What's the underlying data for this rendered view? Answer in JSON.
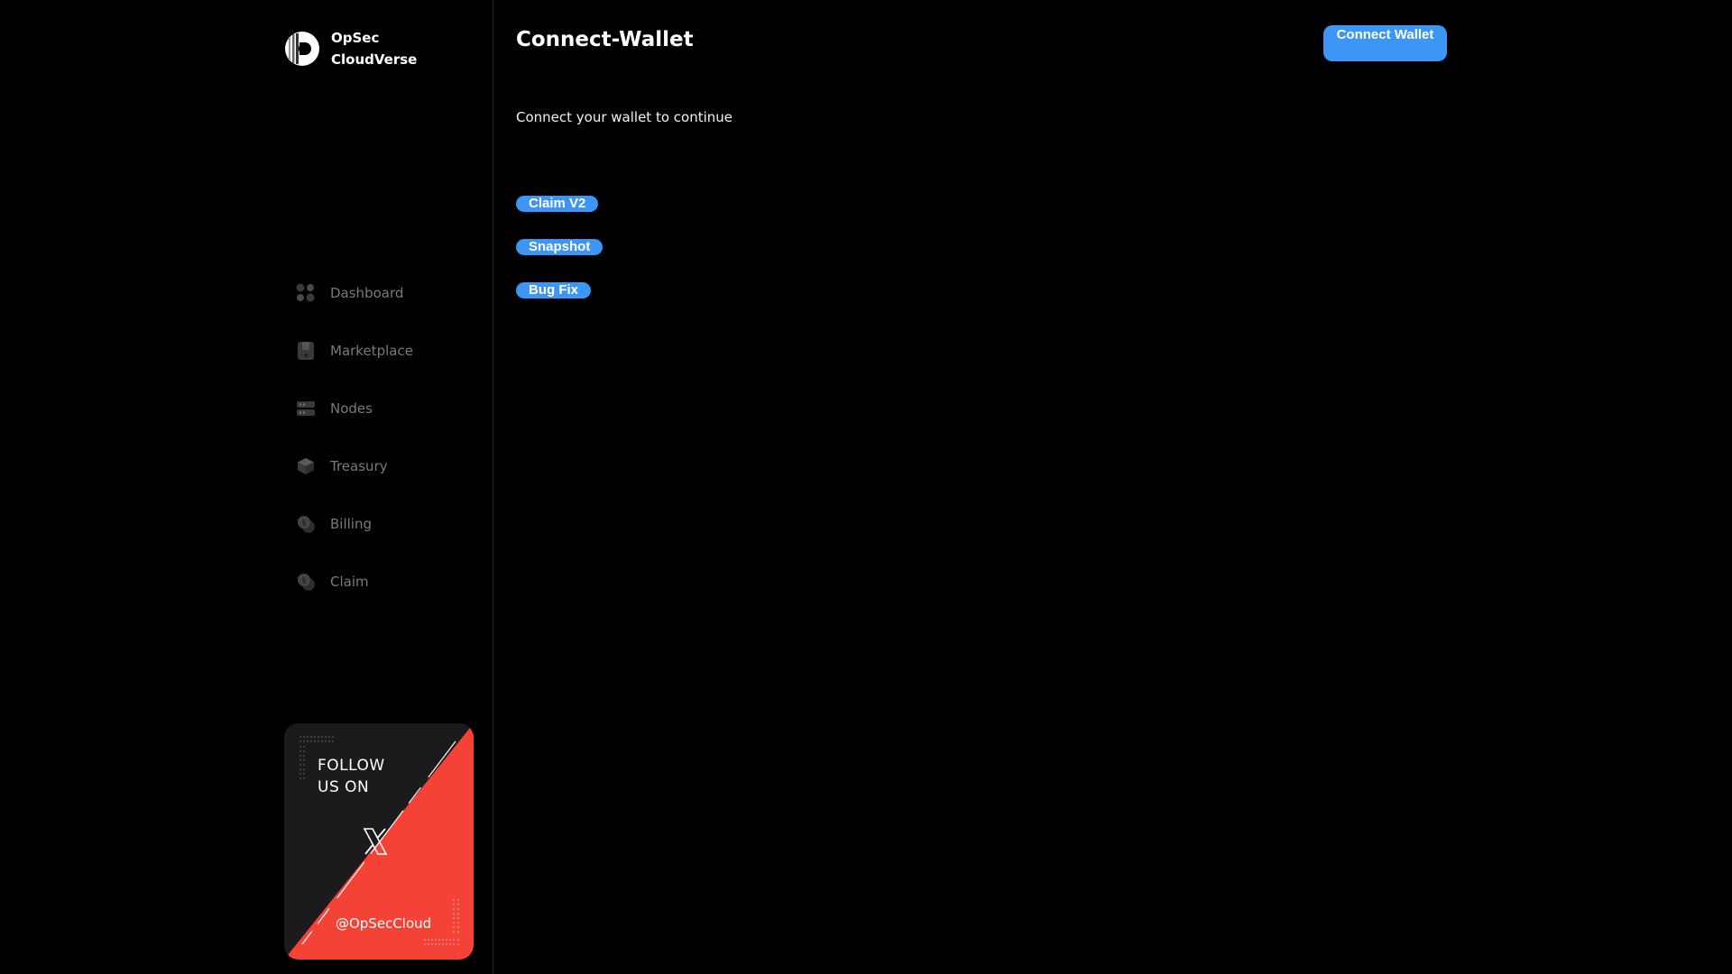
{
  "brand": {
    "line1": "OpSec",
    "line2": "CloudVerse"
  },
  "nav": {
    "items": [
      {
        "label": "Dashboard",
        "icon": "dashboard-icon"
      },
      {
        "label": "Marketplace",
        "icon": "marketplace-icon"
      },
      {
        "label": "Nodes",
        "icon": "nodes-icon"
      },
      {
        "label": "Treasury",
        "icon": "treasury-icon"
      },
      {
        "label": "Billing",
        "icon": "billing-icon"
      },
      {
        "label": "Claim",
        "icon": "claim-icon"
      }
    ]
  },
  "follow_card": {
    "line1": "FOLLOW",
    "line2": "US ON",
    "icon": "x-logo-icon",
    "handle": "@OpSecCloud"
  },
  "header": {
    "title": "Connect-Wallet",
    "connect_label": "Connect Wallet"
  },
  "main": {
    "subtitle": "Connect your wallet to continue",
    "pills": [
      "Claim V2",
      "Snapshot",
      "Bug Fix"
    ]
  },
  "colors": {
    "background": "#000000",
    "accent": "#3d95f5",
    "card_red": "#f44336",
    "nav_text": "#7a7a7a"
  }
}
